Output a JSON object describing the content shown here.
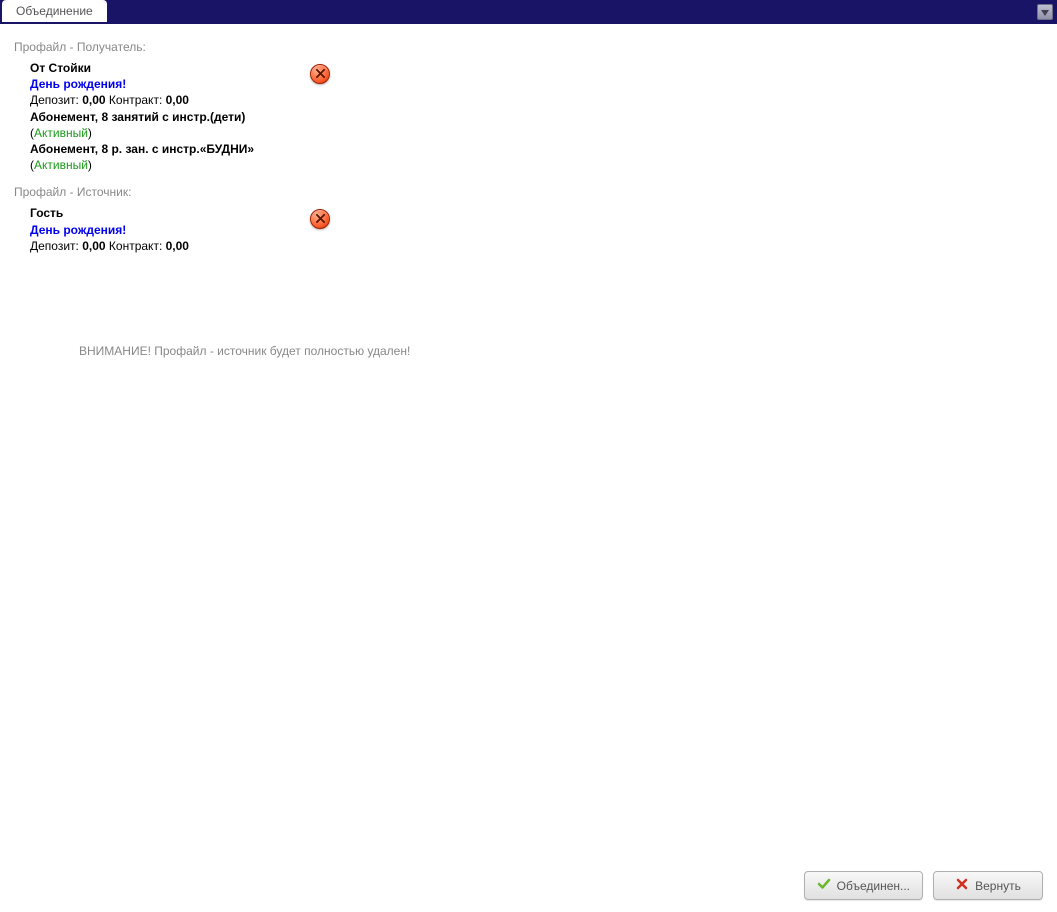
{
  "tab_label": "Объединение",
  "receiver_section_label": "Профайл - Получатель:",
  "source_section_label": "Профайл - Источник:",
  "receiver": {
    "name": "От Стойки",
    "birthday": "День рождения!",
    "deposit_label": "Депозит:",
    "deposit_value": "0,00",
    "contract_label": "Контракт:",
    "contract_value": "0,00",
    "subscriptions": [
      {
        "title": "Абонемент, 8 занятий с инстр.(дети)",
        "status": "Активный"
      },
      {
        "title": "Абонемент, 8 р. зан. с инстр.«БУДНИ»",
        "status": "Активный"
      }
    ]
  },
  "source": {
    "name": "Гость",
    "birthday": "День рождения!",
    "deposit_label": "Депозит:",
    "deposit_value": "0,00",
    "contract_label": "Контракт:",
    "contract_value": "0,00"
  },
  "warning": "ВНИМАНИЕ! Профайл - источник будет полностью удален!",
  "merge_button": "Объединен...",
  "cancel_button": "Вернуть"
}
